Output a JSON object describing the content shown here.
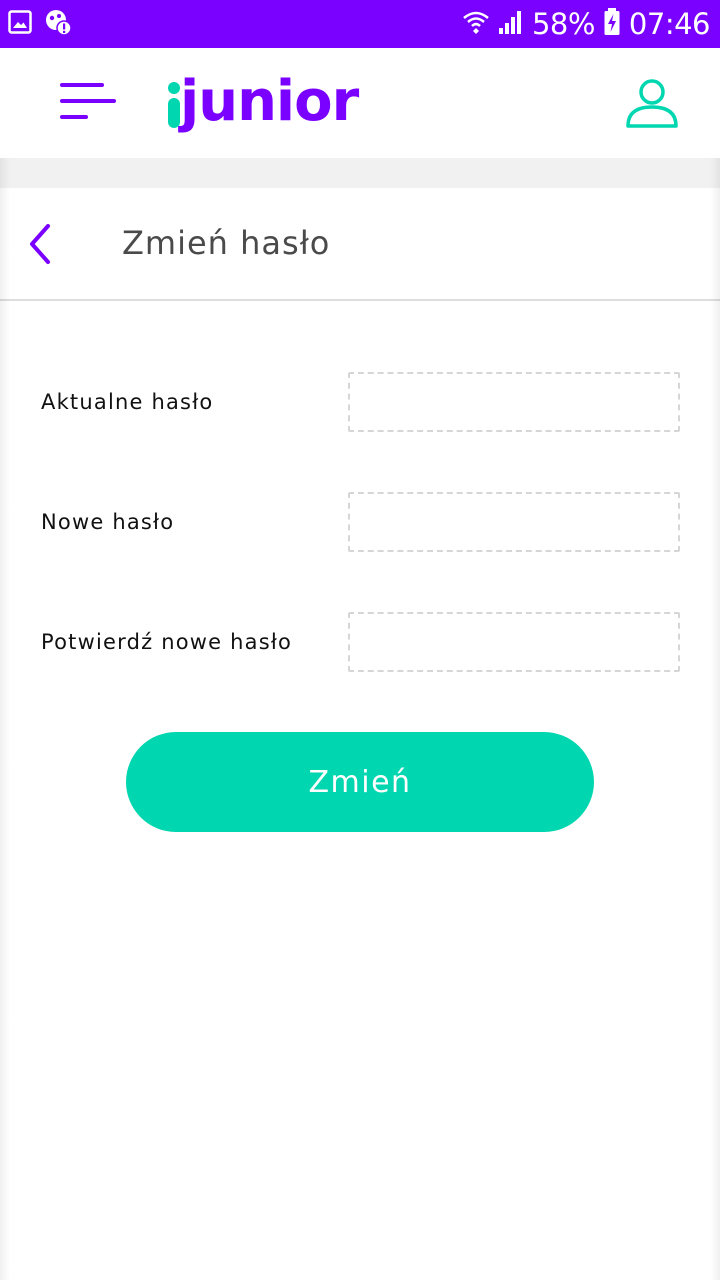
{
  "status_bar": {
    "battery": "58%",
    "time": "07:46",
    "icons": [
      "gallery-icon",
      "notification-alert-icon",
      "wifi-icon",
      "signal-icon",
      "battery-charging-icon"
    ]
  },
  "header": {
    "logo_text": "junior",
    "logo_prefix": "i",
    "icons": [
      "menu-icon",
      "user-profile-icon"
    ]
  },
  "page": {
    "title": "Zmień hasło",
    "back_icon": "chevron-left-icon"
  },
  "form": {
    "current_password": {
      "label": "Aktualne hasło",
      "value": "",
      "placeholder": ""
    },
    "new_password": {
      "label": "Nowe hasło",
      "value": "",
      "placeholder": ""
    },
    "confirm_password": {
      "label": "Potwierdź nowe hasło",
      "value": "",
      "placeholder": ""
    },
    "submit_label": "Zmień"
  },
  "colors": {
    "brand_purple": "#7a00ff",
    "brand_teal": "#00d6b0",
    "status_bar": "#7a00ff"
  }
}
